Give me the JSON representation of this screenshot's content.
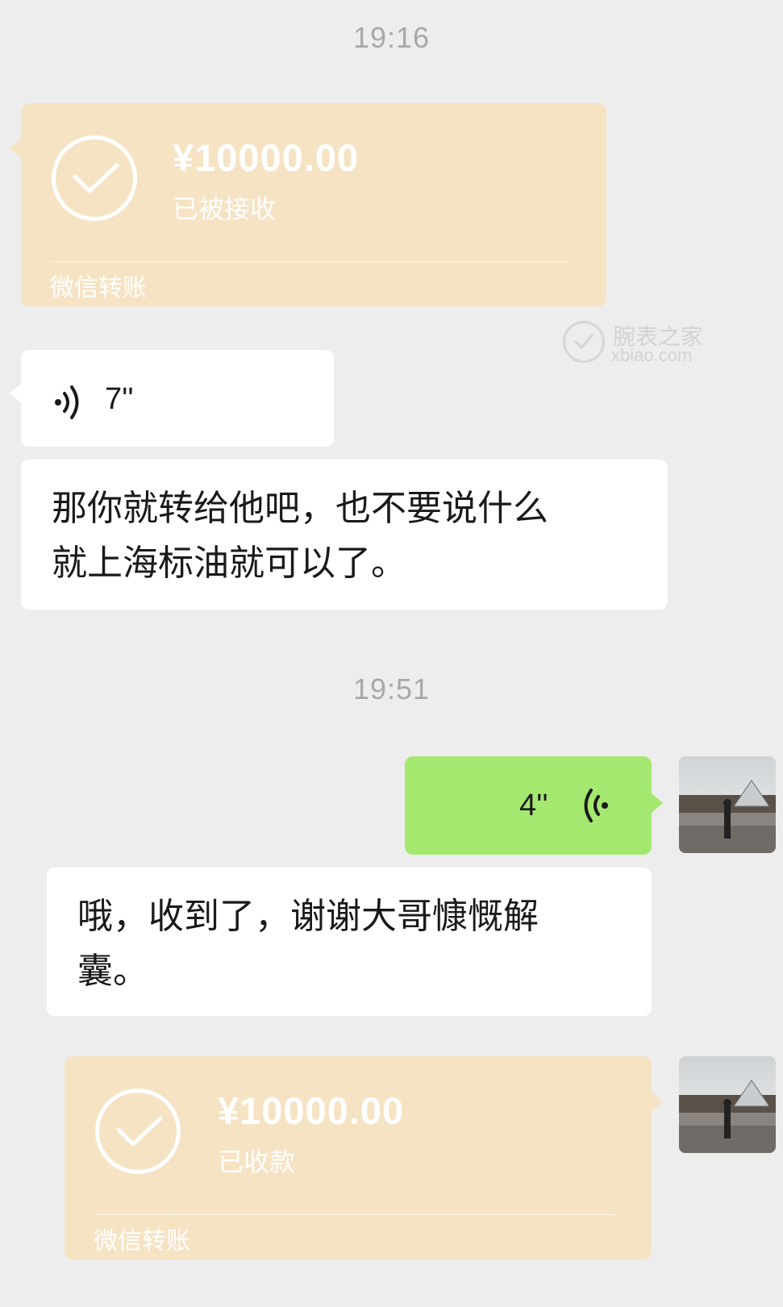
{
  "timestamps": [
    "19:16",
    "19:51"
  ],
  "transfer_received_by_other": {
    "amount": "¥10000.00",
    "status": "已被接收",
    "brand": "微信转账"
  },
  "voice_incoming": {
    "duration": "7''"
  },
  "text_incoming_1": {
    "line1": "那你就转给他吧，也不要说什么",
    "line2": "就上海标油就可以了。"
  },
  "voice_outgoing": {
    "duration": "4''"
  },
  "text_outgoing_1": {
    "line1": "哦，收到了，谢谢大哥慷慨解",
    "line2": "囊。"
  },
  "transfer_received_self": {
    "amount": "¥10000.00",
    "status": "已收款",
    "brand": "微信转账"
  },
  "watermark": {
    "cn": "腕表之家",
    "en": "xbiao.com"
  },
  "colors": {
    "background": "#ededed",
    "transfer_card": "#f6e3c4",
    "green_bubble": "#a5e86f",
    "white_bubble": "#ffffff"
  }
}
